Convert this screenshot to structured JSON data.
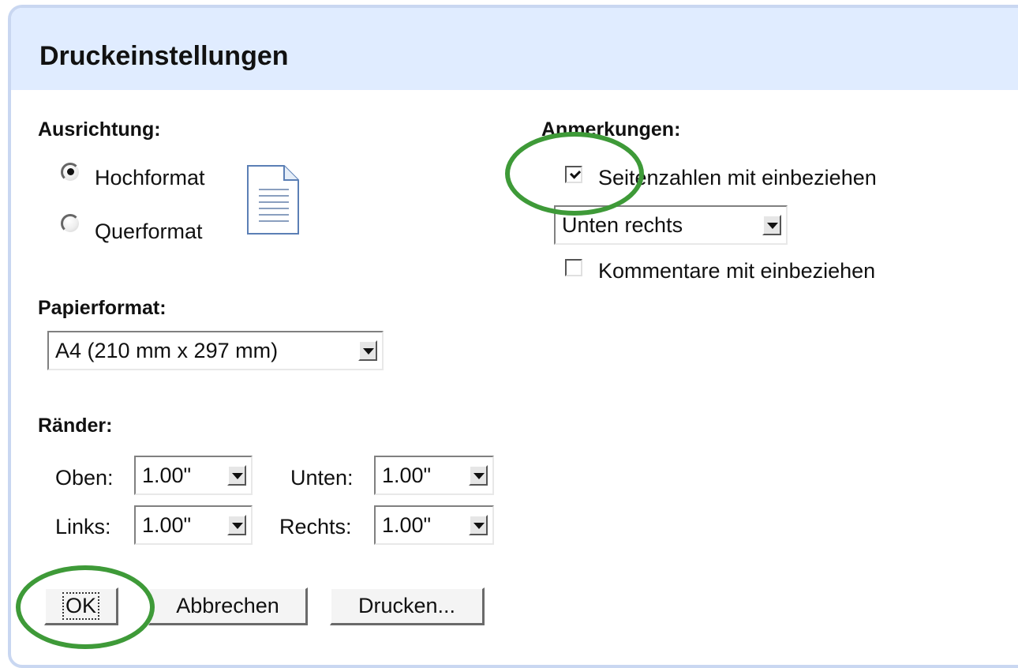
{
  "dialog": {
    "title": "Druckeinstellungen"
  },
  "orientation": {
    "label": "Ausrichtung:",
    "portrait_label": "Hochformat",
    "landscape_label": "Querformat",
    "selected": "Hochformat"
  },
  "paper": {
    "label": "Papierformat:",
    "selected": "A4 (210 mm x 297 mm)"
  },
  "margins": {
    "label": "Ränder:",
    "top_label": "Oben:",
    "top_value": "1.00\"",
    "bottom_label": "Unten:",
    "bottom_value": "1.00\"",
    "left_label": "Links:",
    "left_value": "1.00\"",
    "right_label": "Rechts:",
    "right_value": "1.00\""
  },
  "annotations": {
    "label": "Anmerkungen:",
    "page_numbers_label": "Seitenzahlen mit einbeziehen",
    "page_numbers_checked": true,
    "position_selected": "Unten rechts",
    "comments_label": "Kommentare mit einbeziehen",
    "comments_checked": false
  },
  "buttons": {
    "ok": "OK",
    "cancel": "Abbrechen",
    "print": "Drucken..."
  },
  "colors": {
    "titlebar_bg": "#e0ecff",
    "dialog_border": "#c9d7f1",
    "highlight_ellipse": "#3e9a38"
  }
}
